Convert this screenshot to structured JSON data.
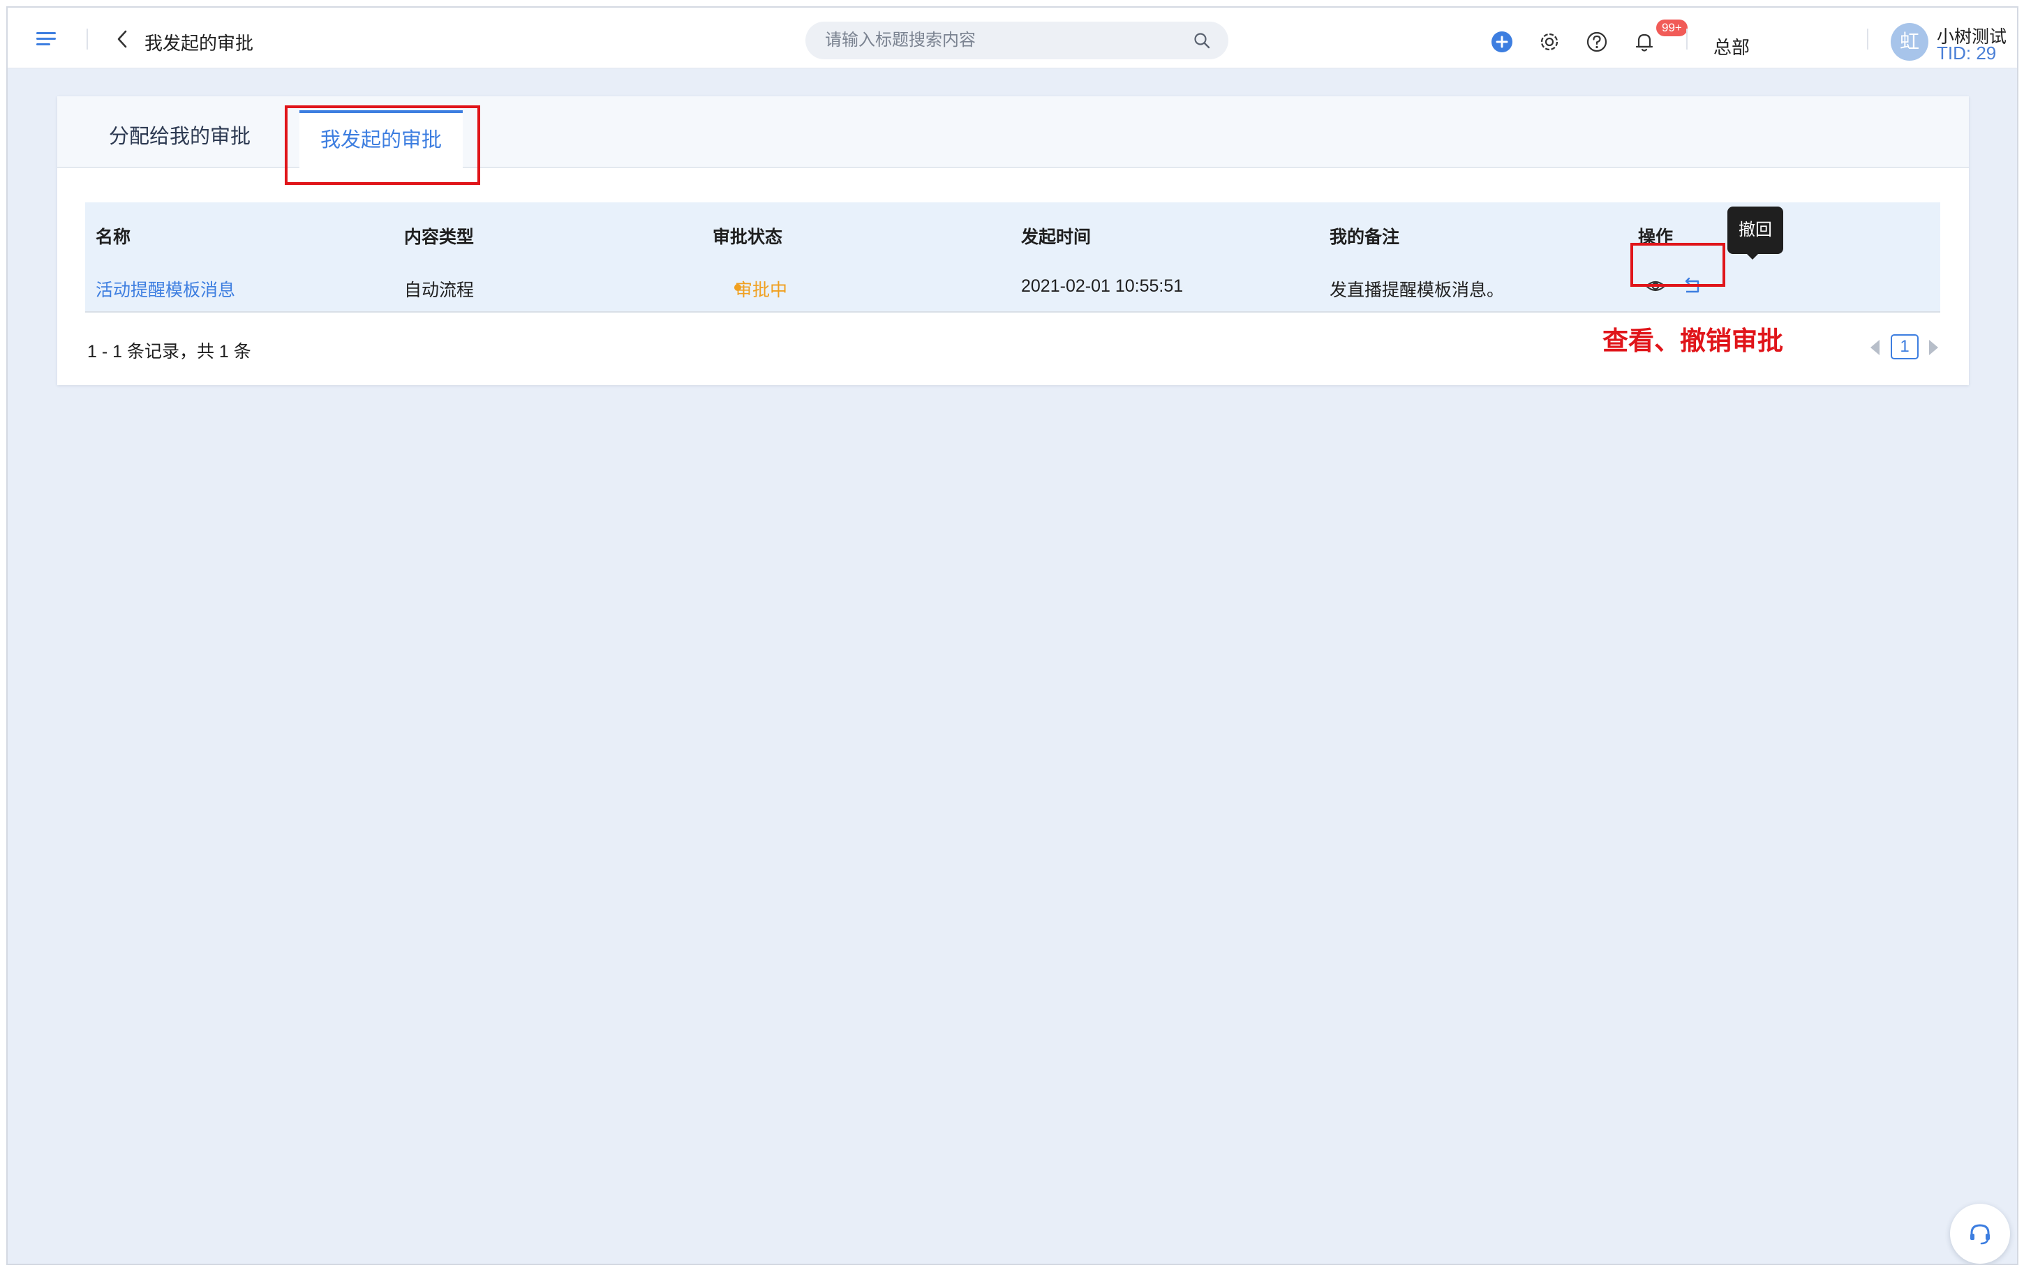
{
  "header": {
    "page_title": "我发起的审批",
    "search_placeholder": "请输入标题搜索内容",
    "notification_badge": "99+",
    "org_name": "总部",
    "avatar_char": "虹",
    "user_name": "小树测试",
    "user_tid": "TID: 29"
  },
  "tabs": [
    {
      "label": "分配给我的审批",
      "active": false
    },
    {
      "label": "我发起的审批",
      "active": true
    }
  ],
  "table": {
    "columns": [
      "名称",
      "内容类型",
      "审批状态",
      "发起时间",
      "我的备注",
      "操作"
    ],
    "rows": [
      {
        "name": "活动提醒模板消息",
        "content_type": "自动流程",
        "status": "审批中",
        "created_at": "2021-02-01 10:55:51",
        "note": "发直播提醒模板消息。"
      }
    ]
  },
  "tooltip": "撤回",
  "annotation": "查看、撤销审批",
  "pagination": {
    "summary": "1 - 1 条记录，共 1 条",
    "current_page": "1"
  },
  "colors": {
    "accent": "#3d7ee0",
    "status_pending": "#f0a020",
    "highlight": "#e0151a",
    "background": "#e8eef8"
  },
  "icons": [
    "menu-icon",
    "back-icon",
    "search-icon",
    "add-icon",
    "settings-icon",
    "help-icon",
    "bell-icon",
    "view-icon",
    "revoke-icon",
    "support-icon"
  ]
}
